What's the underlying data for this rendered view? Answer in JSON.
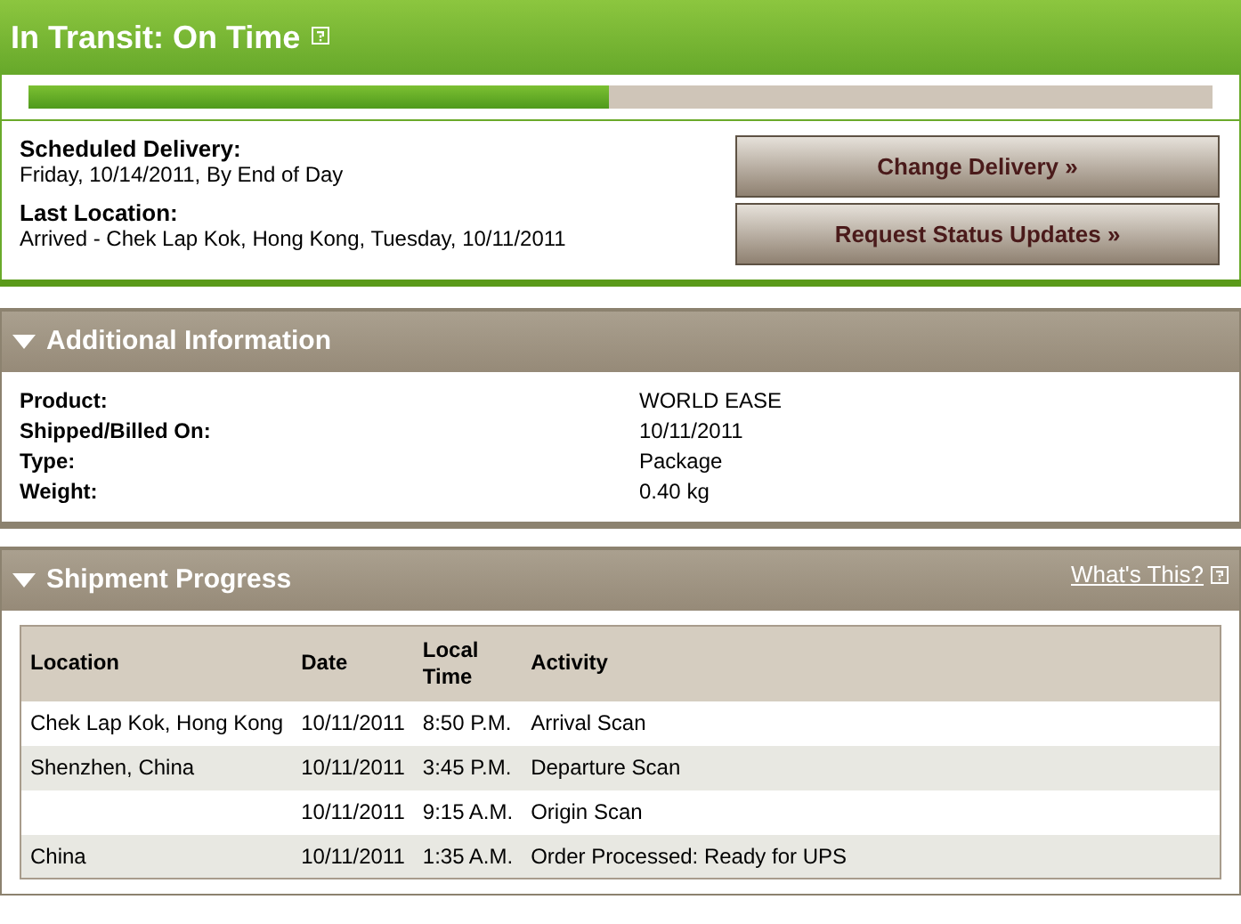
{
  "status": {
    "title": "In Transit: On Time"
  },
  "progress": {
    "level": 0.49
  },
  "delivery": [
    {
      "label": "Scheduled Delivery:",
      "value": "Friday, 10/14/2011, By End of Day"
    },
    {
      "label": "Last Location:",
      "value": "Arrived - Chek Lap Kok, Hong Kong, Tuesday, 10/11/2011"
    }
  ],
  "buttons": [
    "Change Delivery »",
    "Request Status Updates »"
  ],
  "additional": {
    "title": "Additional Information",
    "expanded": true,
    "fields": [
      {
        "label": "Product:",
        "value": "WORLD EASE"
      },
      {
        "label": "Shipped/Billed On:",
        "value": "10/11/2011"
      },
      {
        "label": "Type:",
        "value": "Package"
      },
      {
        "label": "Weight:",
        "value": "0.40 kg"
      }
    ]
  },
  "progress_section": {
    "title": "Shipment Progress",
    "expanded": true,
    "link": "What's This?",
    "table": {
      "columns": [
        "Location",
        "Date",
        "Local Time",
        "Activity"
      ],
      "rows": [
        {
          "location": "Chek Lap Kok, Hong Kong",
          "date": "10/11/2011",
          "time": "8:50 P.M.",
          "activity": "Arrival Scan"
        },
        {
          "location": "Shenzhen, China",
          "date": "10/11/2011",
          "time": "3:45 P.M.",
          "activity": "Departure Scan"
        },
        {
          "date": "10/11/2011",
          "time": "9:15 A.M.",
          "activity": "Origin Scan"
        },
        {
          "location": "China",
          "date": "10/11/2011",
          "time": "1:35 A.M.",
          "activity": "Order Processed: Ready for UPS"
        }
      ]
    }
  }
}
